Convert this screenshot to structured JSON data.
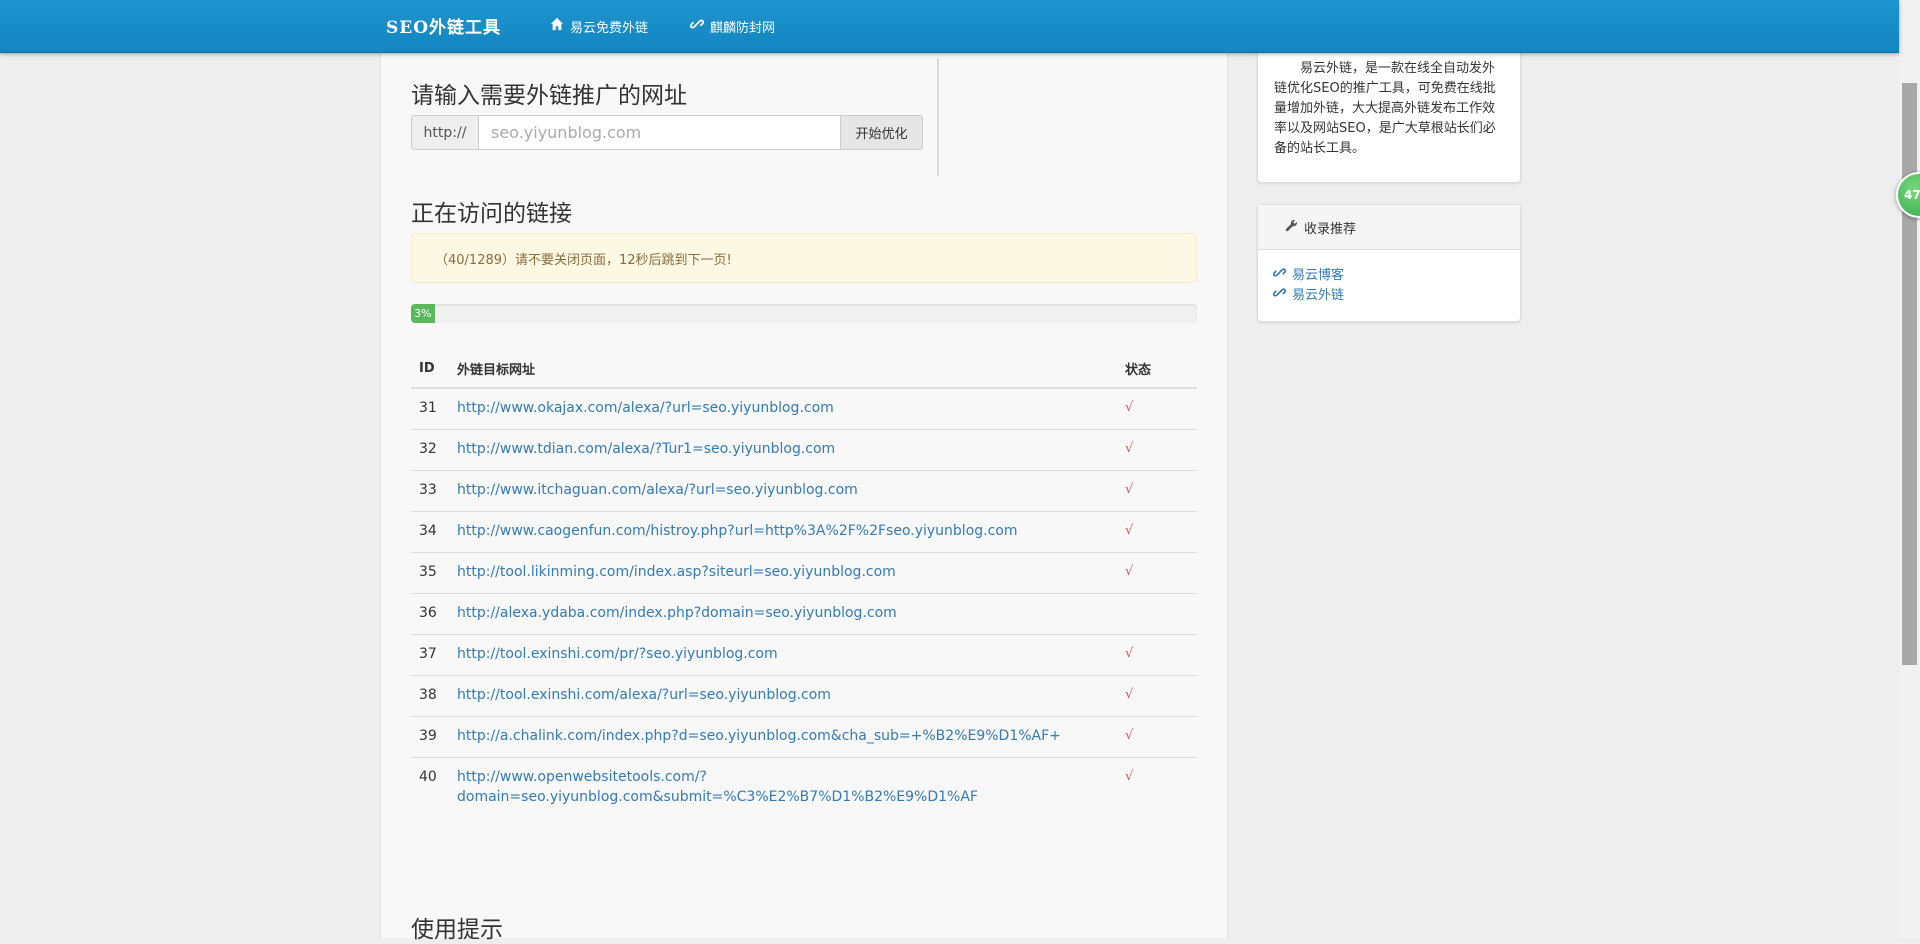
{
  "navbar": {
    "brand": "SEO外链工具",
    "items": [
      {
        "label": "易云免费外链",
        "icon": "home-icon"
      },
      {
        "label": "麒麟防封网",
        "icon": "link-icon"
      }
    ],
    "color": "#1486c1"
  },
  "url_form": {
    "heading": "请输入需要外链推广的网址",
    "prefix": "http://",
    "placeholder": "seo.yiyunblog.com",
    "button": "开始优化"
  },
  "visiting": {
    "heading": "正在访问的链接",
    "alert": "（40/1289）请不要关闭页面，12秒后跳到下一页!",
    "progress": {
      "percent": 3,
      "label": "3%"
    }
  },
  "table": {
    "headers": {
      "id": "ID",
      "url": "外链目标网址",
      "status": "状态"
    },
    "rows": [
      {
        "id": "31",
        "url": "http://www.okajax.com/alexa/?url=seo.yiyunblog.com",
        "status": "√"
      },
      {
        "id": "32",
        "url": "http://www.tdian.com/alexa/?Tur1=seo.yiyunblog.com",
        "status": "√"
      },
      {
        "id": "33",
        "url": "http://www.itchaguan.com/alexa/?url=seo.yiyunblog.com",
        "status": "√"
      },
      {
        "id": "34",
        "url": "http://www.caogenfun.com/histroy.php?url=http%3A%2F%2Fseo.yiyunblog.com",
        "status": "√"
      },
      {
        "id": "35",
        "url": "http://tool.likinming.com/index.asp?siteurl=seo.yiyunblog.com",
        "status": "√"
      },
      {
        "id": "36",
        "url": "http://alexa.ydaba.com/index.php?domain=seo.yiyunblog.com",
        "status": ""
      },
      {
        "id": "37",
        "url": "http://tool.exinshi.com/pr/?seo.yiyunblog.com",
        "status": "√"
      },
      {
        "id": "38",
        "url": "http://tool.exinshi.com/alexa/?url=seo.yiyunblog.com",
        "status": "√"
      },
      {
        "id": "39",
        "url": "http://a.chalink.com/index.php?d=seo.yiyunblog.com&cha_sub=+%B2%E9%D1%AF+",
        "status": "√"
      },
      {
        "id": "40",
        "url": "http://www.openwebsitetools.com/?domain=seo.yiyunblog.com&submit=%C3%E2%B7%D1%B2%E9%D1%AF",
        "status": "√"
      }
    ]
  },
  "tips": {
    "heading": "使用提示"
  },
  "sidebar": {
    "intro": "易云外链，是一款在线全自动发外链优化SEO的推广工具，可免费在线批量增加外链，大大提高外链发布工作效率以及网站SEO，是广大草根站长们必备的站长工具。",
    "recommend": {
      "heading": "收录推荐",
      "links": [
        "易云博客",
        "易云外链"
      ]
    }
  },
  "float_badge": "47"
}
